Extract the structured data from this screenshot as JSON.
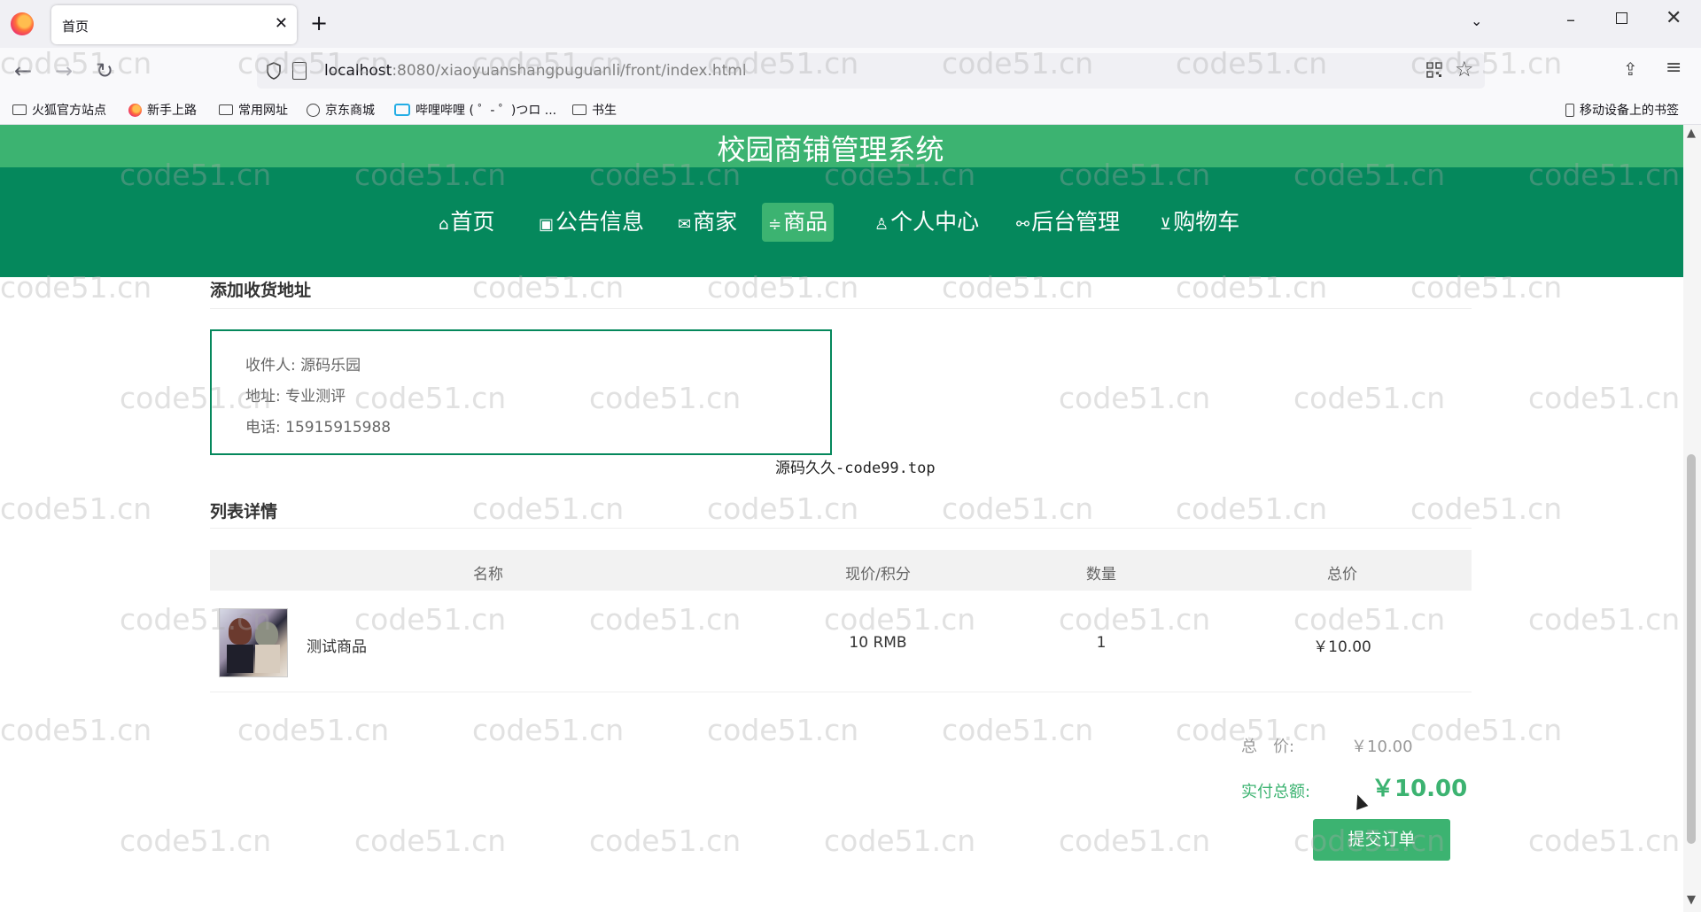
{
  "browser": {
    "tab_title": "首页",
    "url_host": "localhost",
    "url_rest": ":8080/xiaoyuanshangpuguanli/front/index.html",
    "bookmarks": [
      "火狐官方站点",
      "新手上路",
      "常用网址",
      "京东商城",
      "哔哩哔哩 ( ゜- ゜)つロ ...",
      "书生"
    ],
    "mobile_bookmarks": "移动设备上的书签"
  },
  "site": {
    "title": "校园商铺管理系统",
    "menu": [
      {
        "label": "首页",
        "icon": "home-icon"
      },
      {
        "label": "公告信息",
        "icon": "gift-icon"
      },
      {
        "label": "商家",
        "icon": "mail-icon"
      },
      {
        "label": "商品",
        "icon": "sliders-icon",
        "active": true
      },
      {
        "label": "个人中心",
        "icon": "user-icon"
      },
      {
        "label": "后台管理",
        "icon": "link-icon"
      },
      {
        "label": "购物车",
        "icon": "cart-icon"
      }
    ]
  },
  "address": {
    "section_title": "添加收货地址",
    "recipient": "收件人: 源码乐园",
    "addr": "地址: 专业测评",
    "phone": "电话: 15915915988"
  },
  "overlay_text": "源码久久-code99.top",
  "list": {
    "section_title": "列表详情",
    "headers": [
      "名称",
      "现价/积分",
      "数量",
      "总价"
    ],
    "rows": [
      {
        "name": "测试商品",
        "price": "10 RMB",
        "qty": "1",
        "total": "￥10.00"
      }
    ]
  },
  "summary": {
    "total_label": "总　价:",
    "total_value": "￥10.00",
    "pay_label": "实付总额:",
    "pay_value": "￥10.00",
    "submit_label": "提交订单"
  },
  "watermark": "code51.cn",
  "colors": {
    "title_bar": "#3cb371",
    "menu_bar": "#05885c",
    "accent": "#3cb371"
  }
}
